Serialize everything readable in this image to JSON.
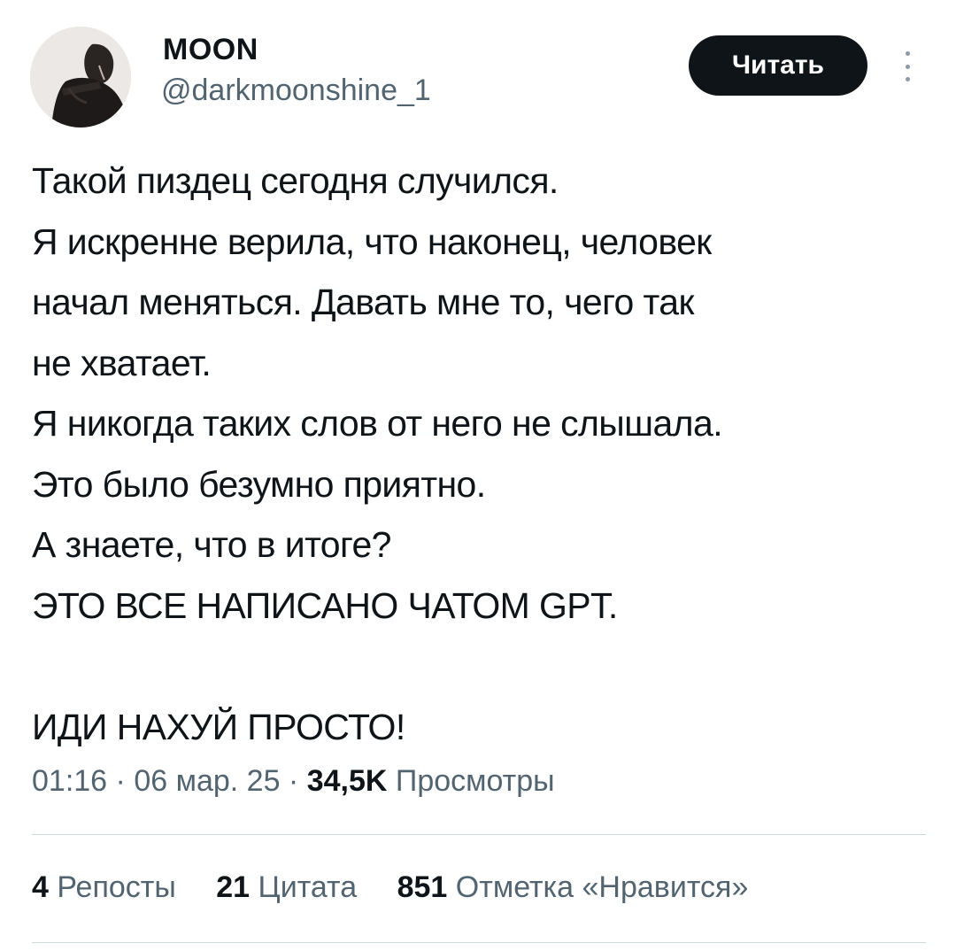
{
  "author": {
    "display_name": "MOON",
    "handle": "@darkmoonshine_1"
  },
  "follow_button": {
    "label": "Читать"
  },
  "more_icon": "more-vertical-icon",
  "tweet": {
    "lines": [
      "Такой пиздец сегодня случился.",
      "Я искренне верила, что наконец, человек",
      "начал меняться. Давать мне то, чего так",
      "не хватает.",
      "Я никогда таких слов от него не слышала.",
      "Это было безумно приятно.",
      "А знаете, что в итоге?",
      "ЭТО ВСЕ НАПИСАНО ЧАТОМ GPT.",
      "",
      "ИДИ НАХУЙ ПРОСТО!"
    ]
  },
  "meta": {
    "time": "01:16",
    "separator": " · ",
    "date": "06 мар. 25",
    "views_count": "34,5K",
    "views_label": "Просмотры"
  },
  "stats": {
    "reposts": {
      "count": "4",
      "label": "Репосты"
    },
    "quotes": {
      "count": "21",
      "label": "Цитата"
    },
    "likes": {
      "count": "851",
      "label": "Отметка «Нравится»"
    }
  },
  "colors": {
    "text_primary": "#0f1419",
    "text_secondary": "#536471",
    "button_bg": "#0f1419",
    "button_text": "#ffffff",
    "divider": "#cfd9de"
  }
}
